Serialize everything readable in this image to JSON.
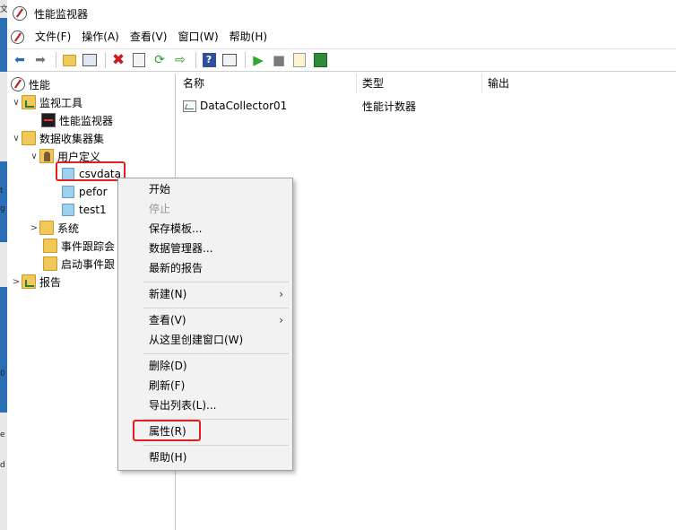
{
  "window": {
    "title": "性能监视器"
  },
  "menu": [
    "文件(F)",
    "操作(A)",
    "查看(V)",
    "窗口(W)",
    "帮助(H)"
  ],
  "toolbar": [
    "back-icon",
    "forward-icon",
    "up-folder-icon",
    "show-hide-tree-icon",
    "delete-icon",
    "properties-icon",
    "refresh-icon",
    "export-icon",
    "help-icon",
    "view-icon",
    "start-icon",
    "stop-icon",
    "new-icon",
    "save-icon"
  ],
  "tree": {
    "root": "性能",
    "monitoring_tools": "监视工具",
    "perf_monitor": "性能监视器",
    "data_collector_sets": "数据收集器集",
    "user_defined": "用户定义",
    "csvdata": "csvdata",
    "peformance": "pefor",
    "test1": "test1",
    "system": "系统",
    "event_trace": "事件跟踪会",
    "startup_event": "启动事件跟",
    "reports": "报告"
  },
  "list": {
    "columns": [
      "名称",
      "类型",
      "输出"
    ],
    "rows": [
      {
        "name": "DataCollector01",
        "type": "性能计数器",
        "output": ""
      }
    ]
  },
  "context_menu": {
    "start": "开始",
    "stop": "停止",
    "save_template": "保存模板...",
    "data_manager": "数据管理器...",
    "latest_report": "最新的报告",
    "new": "新建(N)",
    "view": "查看(V)",
    "new_window": "从这里创建窗口(W)",
    "delete": "删除(D)",
    "refresh": "刷新(F)",
    "export_list": "导出列表(L)...",
    "properties": "属性(R)",
    "help": "帮助(H)"
  },
  "colors": {
    "highlight": "#e02020",
    "accent_blue": "#2a6fb5"
  },
  "edge_strip_text": [
    "文",
    "t",
    "g",
    "0",
    "e",
    "d"
  ]
}
